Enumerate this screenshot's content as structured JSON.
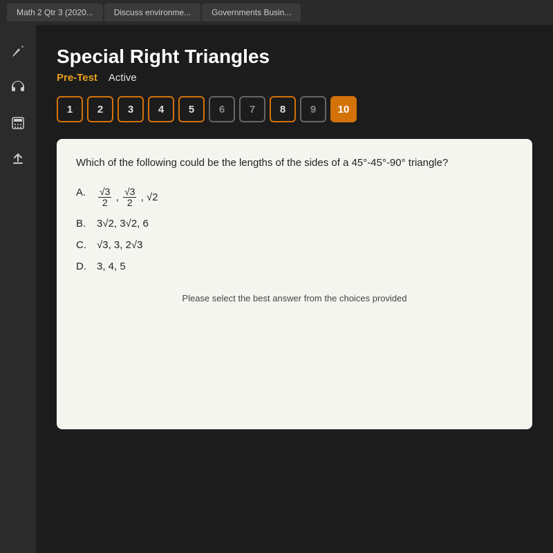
{
  "browser_tabs": [
    {
      "label": "Math 2 Qtr 3 (2020..."
    },
    {
      "label": "Discuss environme..."
    },
    {
      "label": "Governments Busin..."
    }
  ],
  "sidebar": {
    "icons": [
      {
        "name": "pencil",
        "symbol": "✏"
      },
      {
        "name": "headphones",
        "symbol": "🎧"
      },
      {
        "name": "calculator",
        "symbol": "⊞"
      },
      {
        "name": "upload",
        "symbol": "↑"
      }
    ]
  },
  "page": {
    "title": "Special Right Triangles",
    "pre_test_label": "Pre-Test",
    "active_label": "Active",
    "question_numbers": [
      {
        "num": "1",
        "state": "active"
      },
      {
        "num": "2",
        "state": "active"
      },
      {
        "num": "3",
        "state": "active"
      },
      {
        "num": "4",
        "state": "active"
      },
      {
        "num": "5",
        "state": "active"
      },
      {
        "num": "6",
        "state": "inactive"
      },
      {
        "num": "7",
        "state": "inactive"
      },
      {
        "num": "8",
        "state": "active"
      },
      {
        "num": "9",
        "state": "inactive"
      },
      {
        "num": "10",
        "state": "current"
      }
    ],
    "question_text": "Which of the following could be the lengths of the sides of a 4",
    "answer_footer": "Please select the best answer from the choices provided"
  }
}
